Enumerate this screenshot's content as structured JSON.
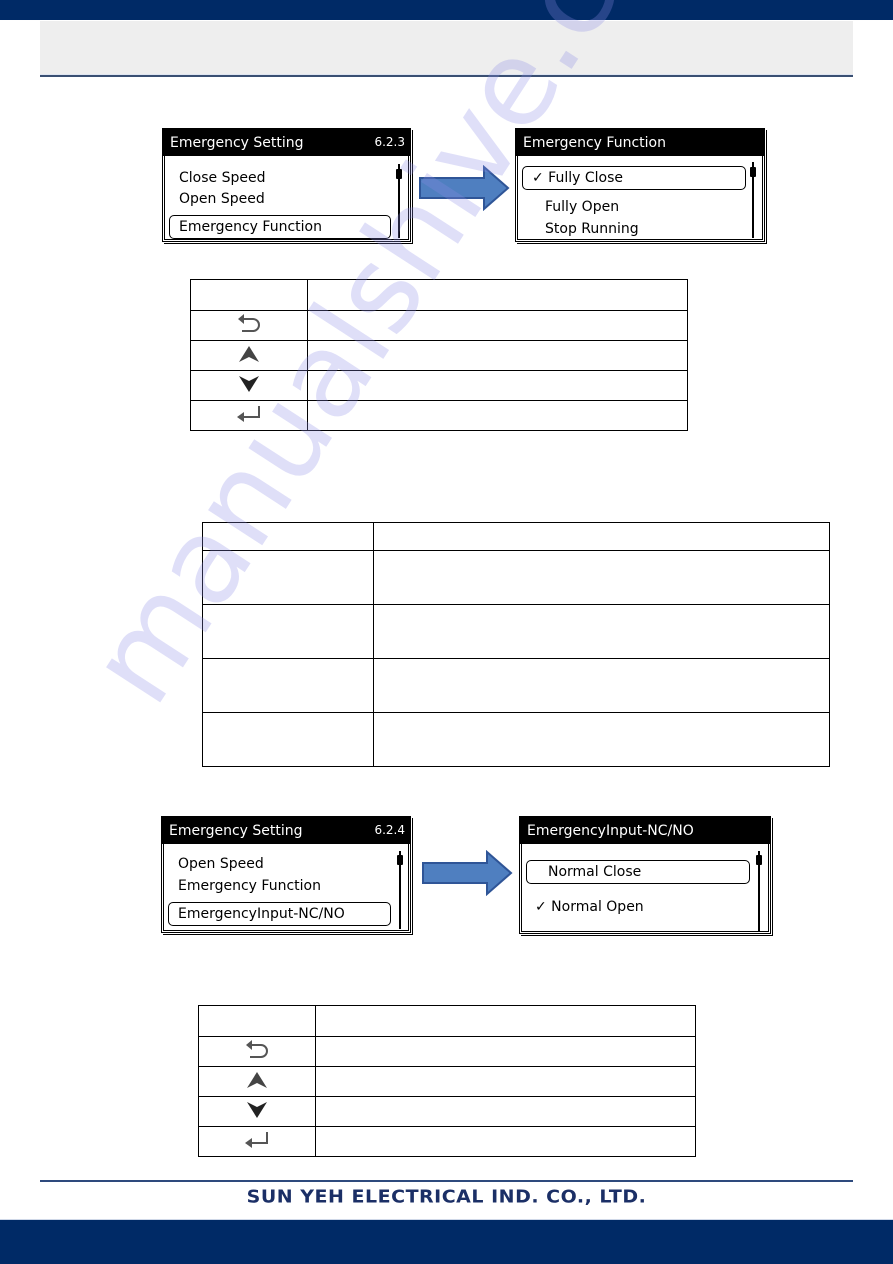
{
  "header": {
    "title": ""
  },
  "screen_623": {
    "title": "Emergency Setting",
    "version": "6.2.3",
    "items": [
      "Close Speed",
      "Open Speed"
    ],
    "selected": "Emergency Function"
  },
  "screen_function": {
    "title": "Emergency Function",
    "selected": "✓ Fully Close",
    "items": [
      "Fully Open",
      "Stop Running"
    ]
  },
  "key_table_1": {
    "rows": [
      {
        "icon": "header",
        "desc": ""
      },
      {
        "icon": "back-icon",
        "glyph": "back",
        "desc": ""
      },
      {
        "icon": "up-icon",
        "glyph": "up",
        "desc": ""
      },
      {
        "icon": "down-icon",
        "glyph": "down",
        "desc": ""
      },
      {
        "icon": "enter-icon",
        "glyph": "enter",
        "desc": ""
      }
    ]
  },
  "function_table": {
    "rows": [
      {
        "option": "",
        "description": ""
      },
      {
        "option": "",
        "description": ""
      },
      {
        "option": "",
        "description": ""
      },
      {
        "option": "",
        "description": ""
      },
      {
        "option": "",
        "description": ""
      }
    ]
  },
  "screen_624": {
    "title": "Emergency Setting",
    "version": "6.2.4",
    "items": [
      "Open Speed",
      "Emergency Function"
    ],
    "selected": "EmergencyInput-NC/NO"
  },
  "screen_ncno": {
    "title": "EmergencyInput-NC/NO",
    "selected": "Normal Close",
    "items": [
      "✓ Normal Open"
    ]
  },
  "key_table_2": {
    "rows": [
      {
        "icon": "header",
        "desc": ""
      },
      {
        "icon": "back-icon",
        "desc": ""
      },
      {
        "icon": "up-icon",
        "desc": ""
      },
      {
        "icon": "down-icon",
        "desc": ""
      },
      {
        "icon": "enter-icon",
        "desc": ""
      }
    ]
  },
  "footer": {
    "company": "SUN YEH ELECTRICAL IND. CO., LTD."
  },
  "watermark": "manualshive.com",
  "colors": {
    "brand_navy": "#002a66",
    "arrow_fill": "#4f7fc0",
    "arrow_stroke": "#2f5597"
  }
}
